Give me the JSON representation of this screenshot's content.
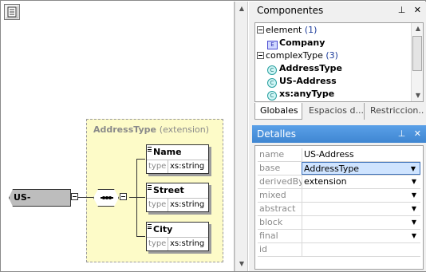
{
  "components": {
    "title": "Componentes",
    "pin_icon": "ᵖ",
    "close_icon": "✕",
    "tree": [
      {
        "label": "element",
        "count": "(1)"
      },
      {
        "label": "Company"
      },
      {
        "label": "complexType",
        "count": "(3)"
      },
      {
        "label": "AddressType"
      },
      {
        "label": "US-Address"
      },
      {
        "label": "xs:anyType"
      }
    ],
    "tabs": [
      "Globales",
      "Espacios d...",
      "Restriccion..."
    ],
    "active_tab": "Globales"
  },
  "details": {
    "title": "Detalles",
    "rows": [
      {
        "name": "name",
        "value": "US-Address"
      },
      {
        "name": "base",
        "value": "AddressType"
      },
      {
        "name": "derivedBy",
        "value": "extension"
      },
      {
        "name": "mixed",
        "value": ""
      },
      {
        "name": "abstract",
        "value": ""
      },
      {
        "name": "block",
        "value": ""
      },
      {
        "name": "final",
        "value": ""
      },
      {
        "name": "id",
        "value": ""
      }
    ]
  },
  "diagram": {
    "root": "US-Address",
    "extension_base": "AddressType",
    "extension_kind": "(extension)",
    "type_label": "type",
    "elements": [
      {
        "name": "Name",
        "type": "xs:string"
      },
      {
        "name": "Street",
        "type": "xs:string"
      },
      {
        "name": "City",
        "type": "xs:string"
      }
    ]
  },
  "colors": {
    "accent": "#3c8ad9",
    "extension_bg": "#fdfbc8",
    "selected_bg": "#cfe4ff"
  }
}
